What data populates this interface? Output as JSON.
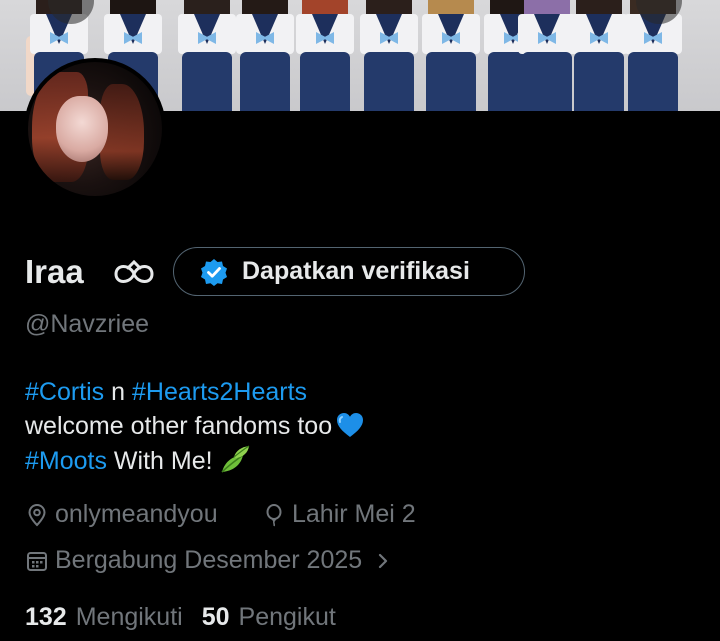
{
  "profile": {
    "display_name": "Iraa",
    "name_icon": "lemniscate-ribbon-icon",
    "handle": "@Navzriee",
    "verify_button_label": "Dapatkan verifikasi",
    "bio": {
      "line1_tag1": "#Cortis",
      "line1_mid": " n ",
      "line1_tag2": "#Hearts2Hearts",
      "line2_text": "welcome other fandoms too",
      "line2_emoji": "blue-heart-emoji",
      "line3_tag": "#Moots",
      "line3_text": " With Me!",
      "line3_emoji": "leaf-emoji"
    },
    "location": "onlymeandyou",
    "birthday": "Lahir Mei 2",
    "joined": "Bergabung Desember 2025",
    "following_count": "132",
    "following_label": "Mengikuti",
    "followers_count": "50",
    "followers_label": "Pengikut"
  },
  "colors": {
    "background": "#000000",
    "text_primary": "#e7e9ea",
    "text_secondary": "#71767b",
    "accent": "#1d9bf0",
    "border": "#536471"
  }
}
